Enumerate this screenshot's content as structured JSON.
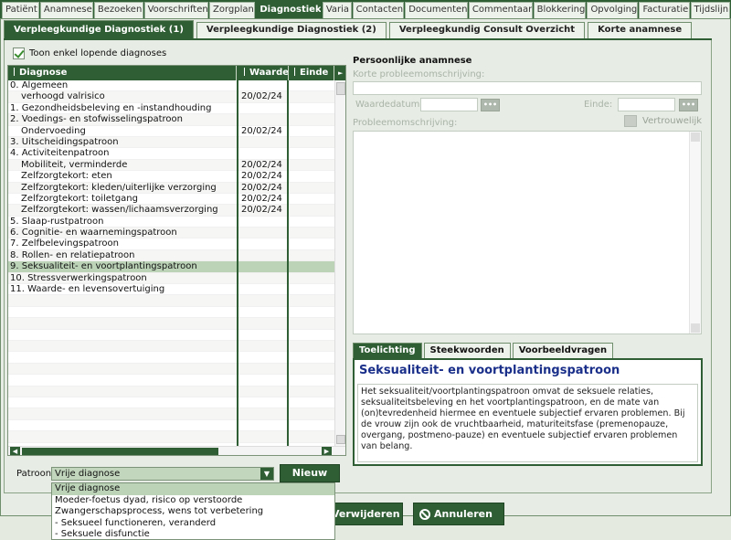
{
  "top_tabs": [
    {
      "label": "Patiënt",
      "active": false
    },
    {
      "label": "Anamnese",
      "active": false
    },
    {
      "label": "Bezoeken",
      "active": false
    },
    {
      "label": "Voorschriften",
      "active": false
    },
    {
      "label": "Zorgplan",
      "active": false
    },
    {
      "label": "Diagnostiek",
      "active": true
    },
    {
      "label": "Varia",
      "active": false
    },
    {
      "label": "Contacten",
      "active": false
    },
    {
      "label": "Documenten",
      "active": false
    },
    {
      "label": "Commentaar",
      "active": false
    },
    {
      "label": "Blokkering",
      "active": false
    },
    {
      "label": "Opvolging",
      "active": false
    },
    {
      "label": "Facturatie",
      "active": false
    },
    {
      "label": "Tijdslijn",
      "active": false
    }
  ],
  "sub_tabs": [
    {
      "label": "Verpleegkundige Diagnostiek (1)",
      "active": true
    },
    {
      "label": "Verpleegkundige Diagnostiek (2)",
      "active": false
    },
    {
      "label": "Verpleegkundig Consult Overzicht",
      "active": false
    },
    {
      "label": "Korte anamnese",
      "active": false
    }
  ],
  "filter": {
    "checkbox_label": "Toon enkel lopende diagnoses",
    "checked": true
  },
  "table": {
    "headers": {
      "diagnose": "Diagnose",
      "waardedatum": "Waardedatum",
      "einde": "Einde"
    },
    "rows": [
      {
        "diagnose": "0. Algemeen",
        "waarde": "",
        "einde": "",
        "indent": false,
        "selected": false
      },
      {
        "diagnose": "verhoogd valrisico",
        "waarde": "20/02/24",
        "einde": "",
        "indent": true,
        "selected": false
      },
      {
        "diagnose": "1. Gezondheidsbeleving en -instandhouding",
        "waarde": "",
        "einde": "",
        "indent": false,
        "selected": false
      },
      {
        "diagnose": "2. Voedings- en stofwisselingspatroon",
        "waarde": "",
        "einde": "",
        "indent": false,
        "selected": false
      },
      {
        "diagnose": "Ondervoeding",
        "waarde": "20/02/24",
        "einde": "",
        "indent": true,
        "selected": false
      },
      {
        "diagnose": "3. Uitscheidingspatroon",
        "waarde": "",
        "einde": "",
        "indent": false,
        "selected": false
      },
      {
        "diagnose": "4. Activiteitenpatroon",
        "waarde": "",
        "einde": "",
        "indent": false,
        "selected": false
      },
      {
        "diagnose": "Mobiliteit, verminderde",
        "waarde": "20/02/24",
        "einde": "",
        "indent": true,
        "selected": false
      },
      {
        "diagnose": "Zelfzorgtekort: eten",
        "waarde": "20/02/24",
        "einde": "",
        "indent": true,
        "selected": false
      },
      {
        "diagnose": "Zelfzorgtekort: kleden/uiterlijke verzorging",
        "waarde": "20/02/24",
        "einde": "",
        "indent": true,
        "selected": false
      },
      {
        "diagnose": "Zelfzorgtekort: toiletgang",
        "waarde": "20/02/24",
        "einde": "",
        "indent": true,
        "selected": false
      },
      {
        "diagnose": "Zelfzorgtekort: wassen/lichaamsverzorging",
        "waarde": "20/02/24",
        "einde": "",
        "indent": true,
        "selected": false
      },
      {
        "diagnose": "5. Slaap-rustpatroon",
        "waarde": "",
        "einde": "",
        "indent": false,
        "selected": false
      },
      {
        "diagnose": "6. Cognitie- en waarnemingspatroon",
        "waarde": "",
        "einde": "",
        "indent": false,
        "selected": false
      },
      {
        "diagnose": "7. Zelfbelevingspatroon",
        "waarde": "",
        "einde": "",
        "indent": false,
        "selected": false
      },
      {
        "diagnose": "8. Rollen- en relatiepatroon",
        "waarde": "",
        "einde": "",
        "indent": false,
        "selected": false
      },
      {
        "diagnose": "9. Seksualiteit- en voortplantingspatroon",
        "waarde": "",
        "einde": "",
        "indent": false,
        "selected": true
      },
      {
        "diagnose": "10. Stressverwerkingspatroon",
        "waarde": "",
        "einde": "",
        "indent": false,
        "selected": false
      },
      {
        "diagnose": "11. Waarde- en levensovertuiging",
        "waarde": "",
        "einde": "",
        "indent": false,
        "selected": false
      }
    ],
    "empty_rows": 13
  },
  "patroon": {
    "label": "Patroon",
    "selected": "Vrije diagnose",
    "new_button": "Nieuw",
    "options": [
      {
        "label": "Vrije diagnose",
        "selected": true
      },
      {
        "label": "Moeder-foetus dyad, risico op verstoorde",
        "selected": false
      },
      {
        "label": "Zwangerschapsprocess, wens tot verbetering",
        "selected": false
      },
      {
        "label": " - Seksueel functioneren, veranderd",
        "selected": false
      },
      {
        "label": " - Seksuele disfunctie",
        "selected": false
      }
    ]
  },
  "anamnese": {
    "title": "Persoonlijke anamnese",
    "short_label": "Korte probleemomschrijving:",
    "short_value": "",
    "waarde_label": "Waardedatum:",
    "waarde_value": "",
    "einde_label": "Einde:",
    "einde_value": "",
    "dots": "•••",
    "desc_label": "Probleemomschrijving:",
    "confidential_label": "Vertrouwelijk",
    "desc_value": ""
  },
  "info_tabs": [
    {
      "label": "Toelichting",
      "active": true
    },
    {
      "label": "Steekwoorden",
      "active": false
    },
    {
      "label": "Voorbeeldvragen",
      "active": false
    }
  ],
  "info": {
    "title": "Seksualiteit- en voortplantingspatroon",
    "text": "Het seksualiteit/voortplantingspatroon omvat de seksuele relaties, seksualiteitsbeleving en het voortplantingspatroon, en de mate van (on)tevredenheid hiermee en eventuele subjectief ervaren problemen. Bij de vrouw zijn ook de vruchtbaarheid, maturiteitsfase (premenopauze, overgang, postmeno-pauze) en eventuele subjectief ervaren problemen van belang."
  },
  "actions": {
    "delete": "Verwijderen",
    "cancel": "Annuleren"
  },
  "colors": {
    "accent": "#2f5e35",
    "selection": "#bcd3b8",
    "title_blue": "#1a2f8a"
  }
}
